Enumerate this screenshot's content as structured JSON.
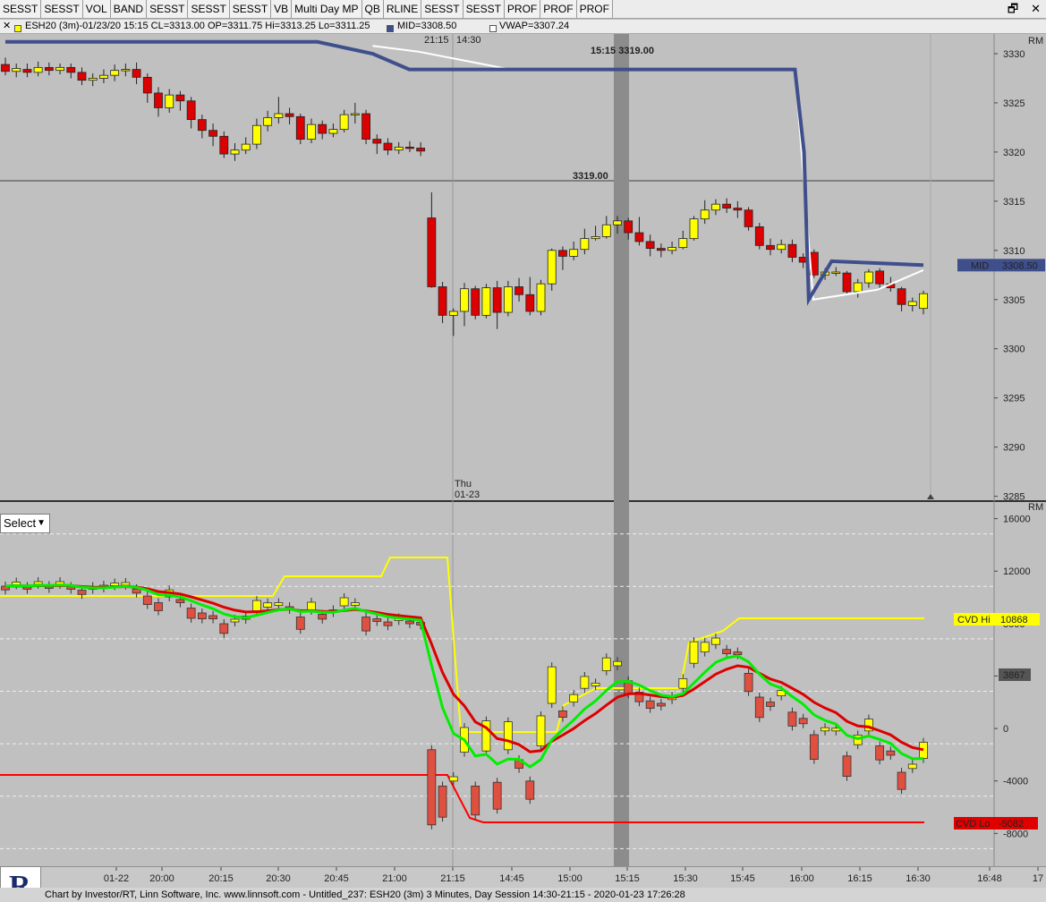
{
  "toolbar": {
    "buttons": [
      "SESST",
      "SESST",
      "VOL",
      "BAND",
      "SESST",
      "SESST",
      "SESST",
      "VB",
      "Multi Day MP",
      "QB",
      "RLINE",
      "SESST",
      "SESST",
      "PROF",
      "PROF",
      "PROF"
    ]
  },
  "window_controls": {
    "restore": "🗗",
    "close": "✕"
  },
  "infobar": {
    "close_glyph": "✕",
    "symbol_text": "ESH20 (3m)-01/23/20 15:15 CL=3313.00 OP=3311.75 Hi=3313.25 Lo=3311.25",
    "mid_text": "MID=3308.50",
    "vwap_text": "VWAP=3307.24",
    "colors": {
      "candle": "#ffff00",
      "mid": "#3f4f8c",
      "vwap": "#ffffff"
    }
  },
  "top_pane": {
    "time_marks": [
      "21:15",
      "14:30"
    ],
    "highlight_label": "15:15  3319.00",
    "level_label": "3319.00",
    "rm_label": "RM",
    "price_ticks": [
      "3330",
      "3325",
      "3320",
      "3315",
      "3310",
      "3305",
      "3300",
      "3295",
      "3290",
      "3285"
    ],
    "mid_tag": "MID",
    "mid_value": "3308.50",
    "day_marker": [
      "Thu",
      "01-23"
    ]
  },
  "bottom_pane": {
    "rm_label": "RM",
    "ticks": [
      "16000",
      "12000",
      "8000",
      "4000",
      "0",
      "-4000",
      "-8000"
    ],
    "cvd_hi_label": "CVD Hi",
    "cvd_hi_value": "10868",
    "cvd_lo_label": "CVD Lo",
    "cvd_lo_value": "-5082",
    "current_value": "3867"
  },
  "select": {
    "value": "Select"
  },
  "time_axis": {
    "labels": [
      "01-22",
      "20:00",
      "20:15",
      "20:30",
      "20:45",
      "21:00",
      "21:15",
      "14:45",
      "15:00",
      "15:15",
      "15:30",
      "15:45",
      "16:00",
      "16:15",
      "16:30",
      "16:48",
      "17"
    ]
  },
  "status": {
    "text": "Chart by Investor/RT, Linn Software, Inc. www.linnsoft.com - Untitled_237: ESH20 (3m) 3 Minutes, Day Session 14:30-21:15 - 2020-01-23 17:26:28"
  },
  "colors": {
    "bg": "#c0c0c0",
    "up": "#ffff00",
    "down": "#dd0000",
    "mid_line": "#3f4f8c",
    "vwap_line": "#ffffff",
    "cvd_hi": "#ffff00",
    "cvd_lo": "#ff0000",
    "fast_ma": "#00ee00",
    "slow_ma": "#dd0000"
  },
  "chart_data": [
    {
      "type": "candlestick",
      "title": "ESH20 (3m)",
      "y_unit": "price",
      "ylim": [
        3285,
        3332
      ],
      "price_ticks": [
        3330,
        3325,
        3320,
        3315,
        3310,
        3305,
        3300,
        3295,
        3290,
        3285
      ],
      "candles": [
        {
          "o": 3328.9,
          "c": 3328.2,
          "h": 3329.6,
          "l": 3327.8
        },
        {
          "o": 3328.2,
          "c": 3328.5,
          "h": 3329.0,
          "l": 3327.6
        },
        {
          "o": 3328.4,
          "c": 3328.1,
          "h": 3329.0,
          "l": 3327.6
        },
        {
          "o": 3328.1,
          "c": 3328.6,
          "h": 3329.2,
          "l": 3327.7
        },
        {
          "o": 3328.6,
          "c": 3328.3,
          "h": 3329.1,
          "l": 3327.8
        },
        {
          "o": 3328.3,
          "c": 3328.6,
          "h": 3329.0,
          "l": 3327.9
        },
        {
          "o": 3328.6,
          "c": 3328.1,
          "h": 3329.0,
          "l": 3327.5
        },
        {
          "o": 3328.1,
          "c": 3327.3,
          "h": 3328.6,
          "l": 3326.8
        },
        {
          "o": 3327.3,
          "c": 3327.5,
          "h": 3328.0,
          "l": 3326.7
        },
        {
          "o": 3327.5,
          "c": 3327.8,
          "h": 3328.4,
          "l": 3327.0
        },
        {
          "o": 3327.8,
          "c": 3328.3,
          "h": 3328.9,
          "l": 3327.2
        },
        {
          "o": 3328.3,
          "c": 3328.4,
          "h": 3329.0,
          "l": 3327.7
        },
        {
          "o": 3328.4,
          "c": 3327.6,
          "h": 3329.1,
          "l": 3326.9
        },
        {
          "o": 3327.6,
          "c": 3326.0,
          "h": 3328.0,
          "l": 3325.0
        },
        {
          "o": 3326.0,
          "c": 3324.5,
          "h": 3326.6,
          "l": 3323.6
        },
        {
          "o": 3324.5,
          "c": 3325.8,
          "h": 3326.4,
          "l": 3324.0
        },
        {
          "o": 3325.8,
          "c": 3325.2,
          "h": 3326.2,
          "l": 3324.2
        },
        {
          "o": 3325.2,
          "c": 3323.3,
          "h": 3325.6,
          "l": 3322.4
        },
        {
          "o": 3323.3,
          "c": 3322.2,
          "h": 3323.8,
          "l": 3321.4
        },
        {
          "o": 3322.2,
          "c": 3321.6,
          "h": 3322.9,
          "l": 3320.6
        },
        {
          "o": 3321.6,
          "c": 3319.8,
          "h": 3322.1,
          "l": 3319.4
        },
        {
          "o": 3319.8,
          "c": 3320.2,
          "h": 3320.9,
          "l": 3319.1
        },
        {
          "o": 3320.2,
          "c": 3320.8,
          "h": 3321.5,
          "l": 3319.8
        },
        {
          "o": 3320.8,
          "c": 3322.7,
          "h": 3323.4,
          "l": 3320.3
        },
        {
          "o": 3322.7,
          "c": 3323.5,
          "h": 3324.2,
          "l": 3322.1
        },
        {
          "o": 3323.5,
          "c": 3323.9,
          "h": 3325.6,
          "l": 3322.9
        },
        {
          "o": 3323.9,
          "c": 3323.6,
          "h": 3324.5,
          "l": 3322.8
        },
        {
          "o": 3323.6,
          "c": 3321.3,
          "h": 3323.9,
          "l": 3320.8
        },
        {
          "o": 3321.3,
          "c": 3322.8,
          "h": 3323.4,
          "l": 3320.9
        },
        {
          "o": 3322.8,
          "c": 3321.9,
          "h": 3323.2,
          "l": 3321.3
        },
        {
          "o": 3321.9,
          "c": 3322.3,
          "h": 3322.9,
          "l": 3321.5
        },
        {
          "o": 3322.3,
          "c": 3323.8,
          "h": 3324.3,
          "l": 3322.0
        },
        {
          "o": 3323.8,
          "c": 3323.9,
          "h": 3325.0,
          "l": 3322.9
        },
        {
          "o": 3323.9,
          "c": 3321.3,
          "h": 3324.3,
          "l": 3320.8
        },
        {
          "o": 3321.3,
          "c": 3320.9,
          "h": 3321.8,
          "l": 3319.8
        },
        {
          "o": 3320.9,
          "c": 3320.2,
          "h": 3321.4,
          "l": 3319.7
        },
        {
          "o": 3320.2,
          "c": 3320.5,
          "h": 3321.0,
          "l": 3319.8
        },
        {
          "o": 3320.5,
          "c": 3320.4,
          "h": 3321.1,
          "l": 3320.0
        },
        {
          "o": 3320.4,
          "c": 3320.1,
          "h": 3321.0,
          "l": 3319.6
        },
        {
          "o": 3313.3,
          "c": 3306.3,
          "h": 3315.9,
          "l": 3306.2
        },
        {
          "o": 3306.3,
          "c": 3303.4,
          "h": 3306.8,
          "l": 3302.6
        },
        {
          "o": 3303.4,
          "c": 3303.8,
          "h": 3304.1,
          "l": 3301.3
        },
        {
          "o": 3303.8,
          "c": 3306.1,
          "h": 3306.7,
          "l": 3302.3
        },
        {
          "o": 3306.1,
          "c": 3303.4,
          "h": 3306.4,
          "l": 3303.0
        },
        {
          "o": 3303.4,
          "c": 3306.2,
          "h": 3306.6,
          "l": 3303.1
        },
        {
          "o": 3306.2,
          "c": 3303.7,
          "h": 3306.9,
          "l": 3302.0
        },
        {
          "o": 3303.7,
          "c": 3306.3,
          "h": 3306.9,
          "l": 3303.3
        },
        {
          "o": 3306.3,
          "c": 3305.5,
          "h": 3307.2,
          "l": 3304.8
        },
        {
          "o": 3305.5,
          "c": 3303.8,
          "h": 3307.3,
          "l": 3303.4
        },
        {
          "o": 3303.8,
          "c": 3306.6,
          "h": 3307.0,
          "l": 3303.4
        },
        {
          "o": 3306.6,
          "c": 3310.0,
          "h": 3310.2,
          "l": 3305.9
        },
        {
          "o": 3310.0,
          "c": 3309.4,
          "h": 3310.4,
          "l": 3308.0
        },
        {
          "o": 3309.4,
          "c": 3310.1,
          "h": 3310.9,
          "l": 3309.0
        },
        {
          "o": 3310.1,
          "c": 3311.2,
          "h": 3312.2,
          "l": 3309.6
        },
        {
          "o": 3311.2,
          "c": 3311.4,
          "h": 3312.5,
          "l": 3311.0
        },
        {
          "o": 3311.4,
          "c": 3312.6,
          "h": 3313.5,
          "l": 3311.2
        },
        {
          "o": 3312.6,
          "c": 3313.0,
          "h": 3313.5,
          "l": 3311.7
        },
        {
          "o": 3313.0,
          "c": 3311.8,
          "h": 3313.3,
          "l": 3311.1
        },
        {
          "o": 3311.8,
          "c": 3310.9,
          "h": 3313.4,
          "l": 3310.5
        },
        {
          "o": 3310.9,
          "c": 3310.2,
          "h": 3311.6,
          "l": 3309.4
        },
        {
          "o": 3310.2,
          "c": 3310.0,
          "h": 3310.7,
          "l": 3309.3
        },
        {
          "o": 3310.0,
          "c": 3310.3,
          "h": 3310.9,
          "l": 3309.6
        },
        {
          "o": 3310.3,
          "c": 3311.2,
          "h": 3312.0,
          "l": 3310.1
        },
        {
          "o": 3311.2,
          "c": 3313.2,
          "h": 3313.5,
          "l": 3311.0
        },
        {
          "o": 3313.2,
          "c": 3314.1,
          "h": 3315.1,
          "l": 3312.7
        },
        {
          "o": 3314.1,
          "c": 3314.7,
          "h": 3315.2,
          "l": 3313.6
        },
        {
          "o": 3314.7,
          "c": 3314.3,
          "h": 3315.3,
          "l": 3313.8
        },
        {
          "o": 3314.3,
          "c": 3314.1,
          "h": 3315.0,
          "l": 3313.3
        },
        {
          "o": 3314.1,
          "c": 3312.4,
          "h": 3314.4,
          "l": 3312.0
        },
        {
          "o": 3312.4,
          "c": 3310.5,
          "h": 3312.8,
          "l": 3310.1
        },
        {
          "o": 3310.5,
          "c": 3310.1,
          "h": 3311.2,
          "l": 3309.5
        },
        {
          "o": 3310.1,
          "c": 3310.6,
          "h": 3311.1,
          "l": 3309.7
        },
        {
          "o": 3310.6,
          "c": 3309.3,
          "h": 3311.1,
          "l": 3308.8
        },
        {
          "o": 3309.3,
          "c": 3308.8,
          "h": 3309.7,
          "l": 3308.2
        },
        {
          "o": 3309.8,
          "c": 3307.5,
          "h": 3310.1,
          "l": 3307.2
        },
        {
          "o": 3307.5,
          "c": 3307.8,
          "h": 3308.2,
          "l": 3307.0
        },
        {
          "o": 3307.8,
          "c": 3307.8,
          "h": 3308.3,
          "l": 3307.4
        },
        {
          "o": 3307.7,
          "c": 3305.8,
          "h": 3307.9,
          "l": 3305.5
        },
        {
          "o": 3305.8,
          "c": 3306.7,
          "h": 3307.1,
          "l": 3305.2
        },
        {
          "o": 3306.7,
          "c": 3307.8,
          "h": 3308.1,
          "l": 3306.2
        },
        {
          "o": 3307.9,
          "c": 3306.6,
          "h": 3308.2,
          "l": 3306.1
        },
        {
          "o": 3306.6,
          "c": 3306.2,
          "h": 3307.3,
          "l": 3305.8
        },
        {
          "o": 3306.1,
          "c": 3304.5,
          "h": 3306.3,
          "l": 3303.8
        },
        {
          "o": 3304.4,
          "c": 3304.8,
          "h": 3305.2,
          "l": 3303.8
        },
        {
          "o": 3304.1,
          "c": 3305.6,
          "h": 3305.9,
          "l": 3303.5
        }
      ],
      "mid_line": [
        [
          3331.2,
          0
        ],
        [
          3331.2,
          0.34
        ],
        [
          3330.0,
          0.4
        ],
        [
          3328.4,
          0.44
        ],
        [
          3328.4,
          0.86
        ],
        [
          3320.0,
          0.87
        ],
        [
          3305.0,
          0.875
        ],
        [
          3308.9,
          0.9
        ],
        [
          3308.5,
          1.0
        ]
      ],
      "vwap_line": [
        [
          3330.8,
          0.4
        ],
        [
          3330.2,
          0.45
        ],
        [
          3328.4,
          0.55
        ],
        [
          3328.4,
          0.86
        ],
        [
          3305.0,
          0.88
        ],
        [
          3306.0,
          0.95
        ],
        [
          3308.0,
          1.0
        ]
      ],
      "current_mid": 3308.5
    },
    {
      "type": "cvd",
      "title": "CVD",
      "ylim": [
        -10500,
        17200
      ],
      "ticks": [
        16000,
        12000,
        8000,
        4000,
        0,
        -4000,
        -8000
      ],
      "cvd_hi": 10868,
      "cvd_lo": -5082,
      "current": 3867
    }
  ]
}
